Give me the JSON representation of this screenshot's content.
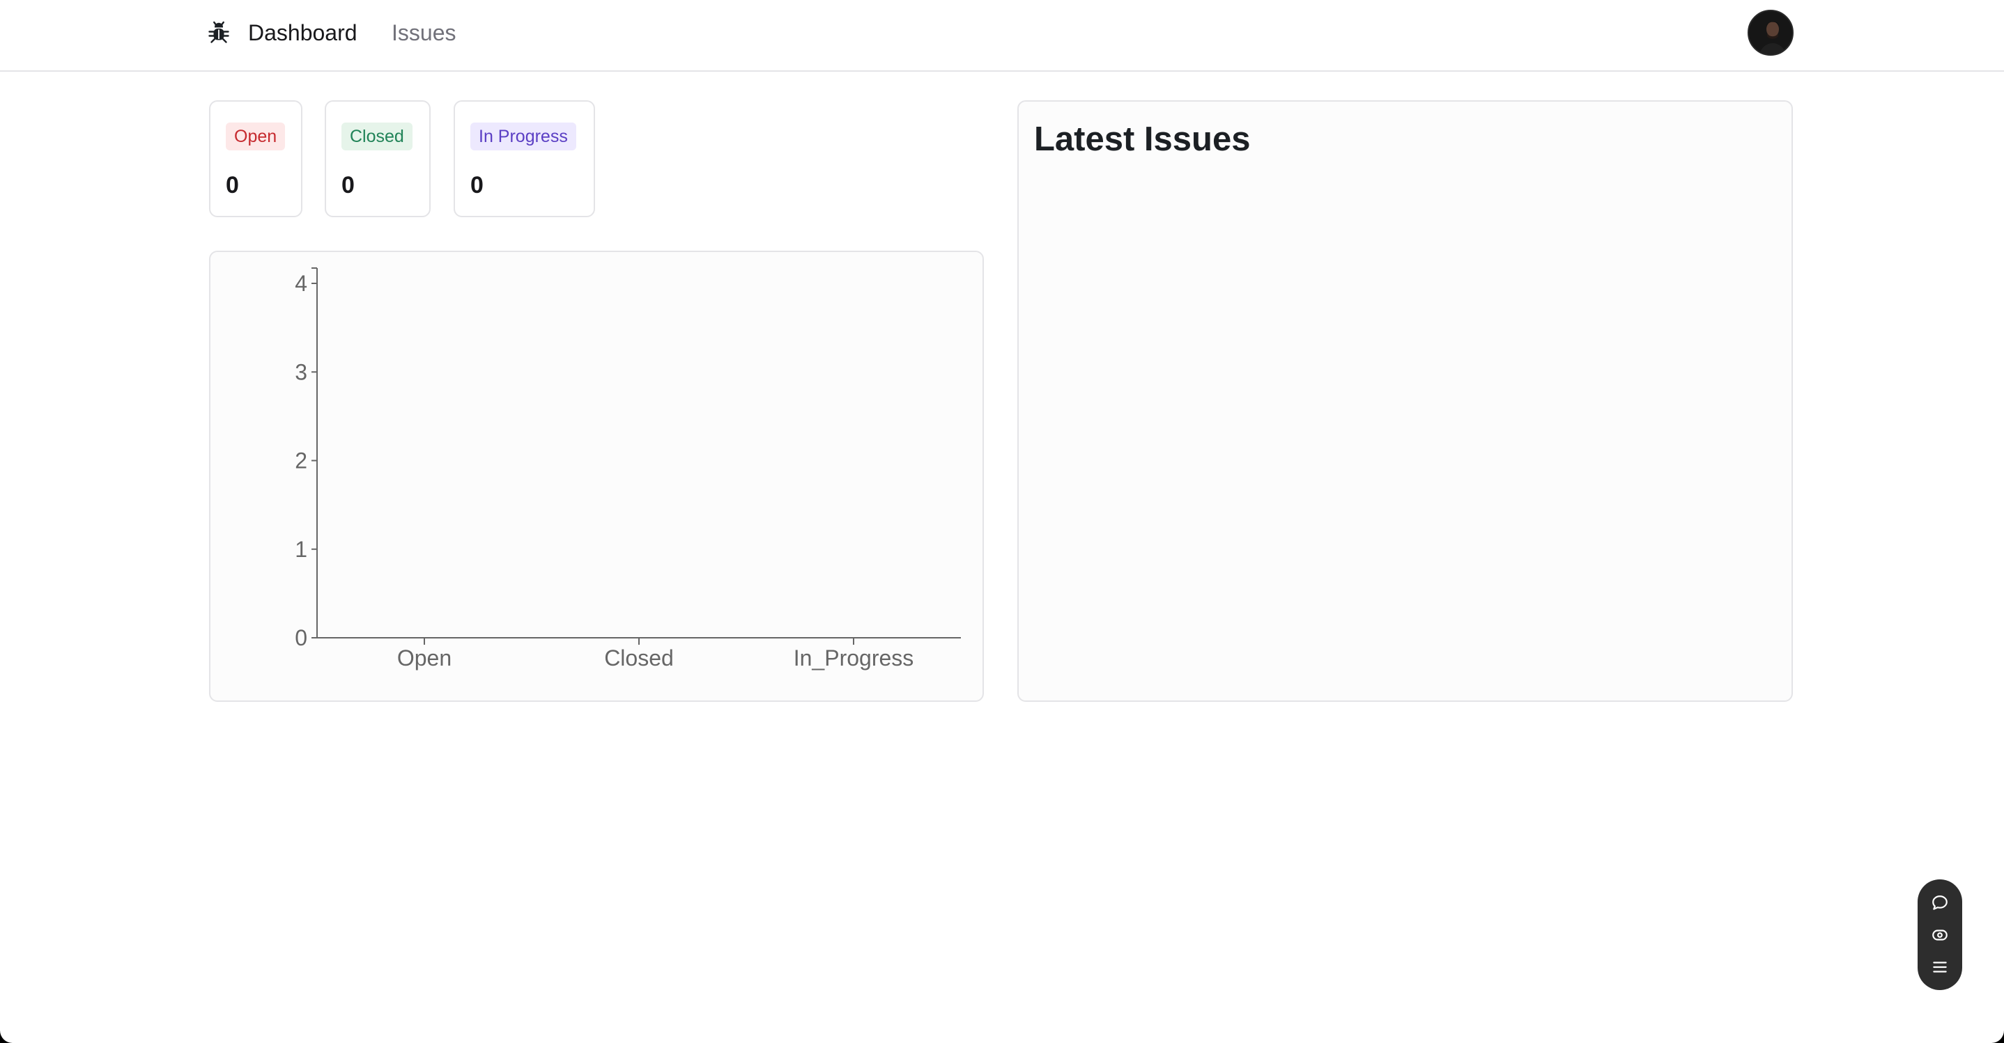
{
  "nav": {
    "logo_icon": "bug-icon",
    "links": [
      {
        "label": "Dashboard",
        "active": true
      },
      {
        "label": "Issues",
        "active": false
      }
    ],
    "avatar_icon": "user-avatar"
  },
  "stats": [
    {
      "label": "Open",
      "count": "0",
      "badge_bg": "#fde8e8",
      "badge_fg": "#c62a2f"
    },
    {
      "label": "Closed",
      "count": "0",
      "badge_bg": "#e6f4ea",
      "badge_fg": "#218358"
    },
    {
      "label": "In Progress",
      "count": "0",
      "badge_bg": "#ede9fe",
      "badge_fg": "#5b3fc4"
    }
  ],
  "chart_data": {
    "type": "bar",
    "categories": [
      "Open",
      "Closed",
      "In_Progress"
    ],
    "values": [
      0,
      0,
      0
    ],
    "yticks": [
      0,
      1,
      2,
      3,
      4
    ],
    "ylim": [
      0,
      4
    ],
    "title": "",
    "xlabel": "",
    "ylabel": "",
    "grid": false,
    "bar_color": "#6e56cf"
  },
  "latest": {
    "title": "Latest Issues",
    "items": []
  },
  "toolbar": {
    "icons": [
      "comment-icon",
      "eye-icon",
      "menu-icon"
    ]
  }
}
